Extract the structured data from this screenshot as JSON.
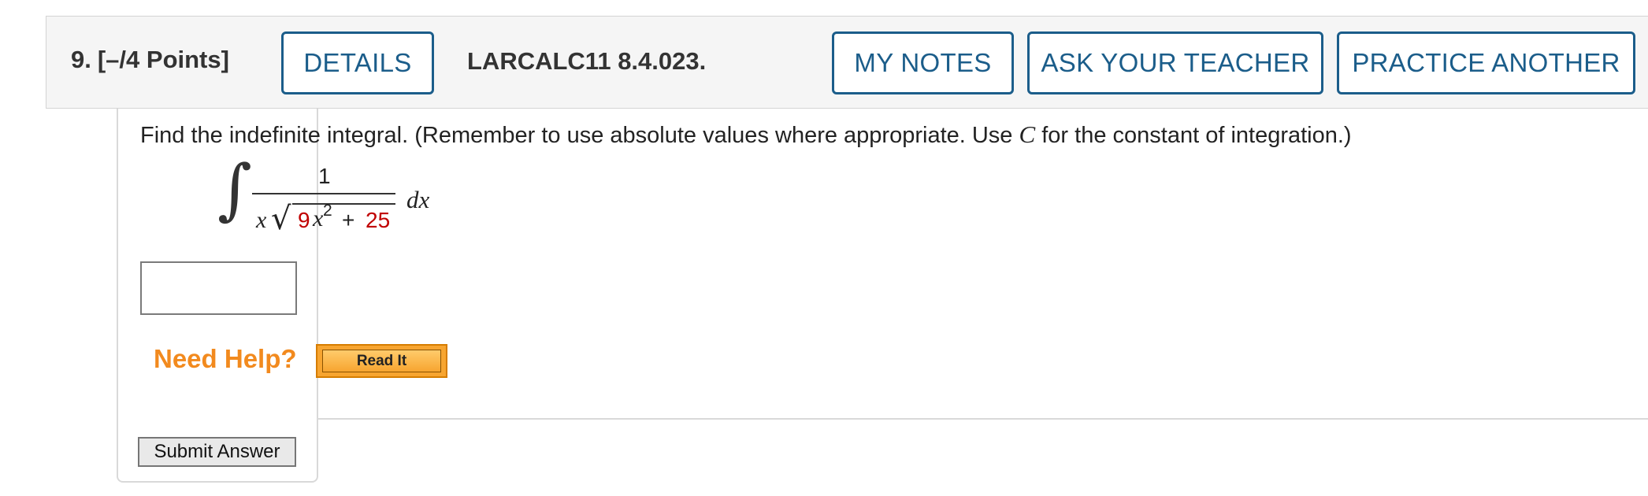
{
  "question": {
    "number": "9.",
    "points": "[–/4 Points]",
    "code": "LARCALC11 8.4.023."
  },
  "header_buttons": {
    "details": "DETAILS",
    "my_notes": "MY NOTES",
    "ask_teacher": "ASK YOUR TEACHER",
    "practice_another": "PRACTICE ANOTHER"
  },
  "prompt": {
    "before_c": "Find the indefinite integral. (Remember to use absolute values where appropriate. Use ",
    "c": "C",
    "after_c": " for the constant of integration.)"
  },
  "integral": {
    "numerator": "1",
    "x": "x",
    "coef": "9",
    "var": "x",
    "exponent": "2",
    "plus": "+",
    "constant": "25",
    "dx": "dx"
  },
  "help": {
    "label": "Need Help?",
    "read_it": "Read It"
  },
  "submit_label": "Submit Answer",
  "colors": {
    "accent": "#1b5d8a",
    "help": "#f28a1e",
    "highlight": "#c00000"
  }
}
